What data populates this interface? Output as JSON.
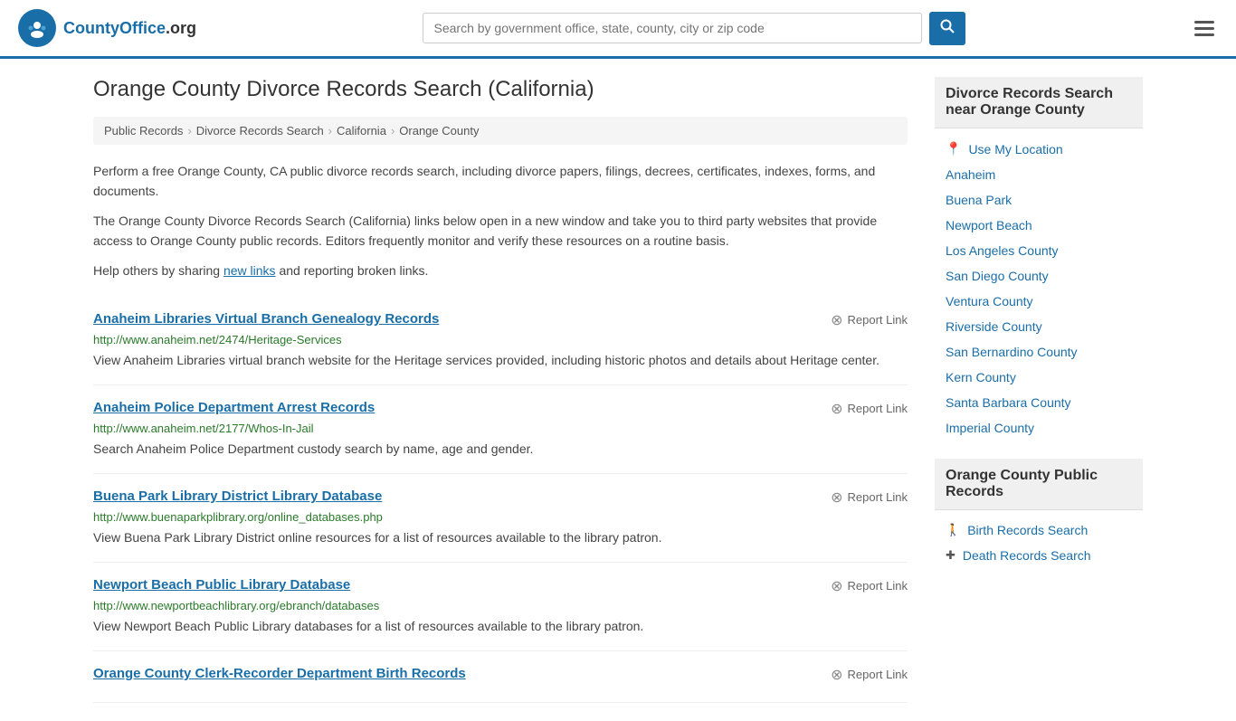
{
  "header": {
    "logo_text": "CountyOffice",
    "logo_suffix": ".org",
    "search_placeholder": "Search by government office, state, county, city or zip code"
  },
  "page": {
    "title": "Orange County Divorce Records Search (California)",
    "breadcrumbs": [
      {
        "label": "Public Records",
        "url": "#"
      },
      {
        "label": "Divorce Records Search",
        "url": "#"
      },
      {
        "label": "California",
        "url": "#"
      },
      {
        "label": "Orange County",
        "url": "#"
      }
    ],
    "description_1": "Perform a free Orange County, CA public divorce records search, including divorce papers, filings, decrees, certificates, indexes, forms, and documents.",
    "description_2": "The Orange County Divorce Records Search (California) links below open in a new window and take you to third party websites that provide access to Orange County public records. Editors frequently monitor and verify these resources on a routine basis.",
    "description_3_prefix": "Help others by sharing ",
    "description_3_link": "new links",
    "description_3_suffix": " and reporting broken links."
  },
  "records": [
    {
      "title": "Anaheim Libraries Virtual Branch Genealogy Records",
      "url": "http://www.anaheim.net/2474/Heritage-Services",
      "description": "View Anaheim Libraries virtual branch website for the Heritage services provided, including historic photos and details about Heritage center.",
      "report_label": "Report Link"
    },
    {
      "title": "Anaheim Police Department Arrest Records",
      "url": "http://www.anaheim.net/2177/Whos-In-Jail",
      "description": "Search Anaheim Police Department custody search by name, age and gender.",
      "report_label": "Report Link"
    },
    {
      "title": "Buena Park Library District Library Database",
      "url": "http://www.buenaparkplibrary.org/online_databases.php",
      "description": "View Buena Park Library District online resources for a list of resources available to the library patron.",
      "report_label": "Report Link"
    },
    {
      "title": "Newport Beach Public Library Database",
      "url": "http://www.newportbeachlibrary.org/ebranch/databases",
      "description": "View Newport Beach Public Library databases for a list of resources available to the library patron.",
      "report_label": "Report Link"
    },
    {
      "title": "Orange County Clerk-Recorder Department Birth Records",
      "url": "",
      "description": "",
      "report_label": "Report Link"
    }
  ],
  "sidebar": {
    "nearby_section_title": "Divorce Records Search near Orange County",
    "use_location_label": "Use My Location",
    "nearby_links": [
      "Anaheim",
      "Buena Park",
      "Newport Beach",
      "Los Angeles County",
      "San Diego County",
      "Ventura County",
      "Riverside County",
      "San Bernardino County",
      "Kern County",
      "Santa Barbara County",
      "Imperial County"
    ],
    "public_records_section_title": "Orange County Public Records",
    "public_records_links": [
      {
        "label": "Birth Records Search",
        "icon": "person"
      },
      {
        "label": "Death Records Search",
        "icon": "cross"
      }
    ]
  }
}
